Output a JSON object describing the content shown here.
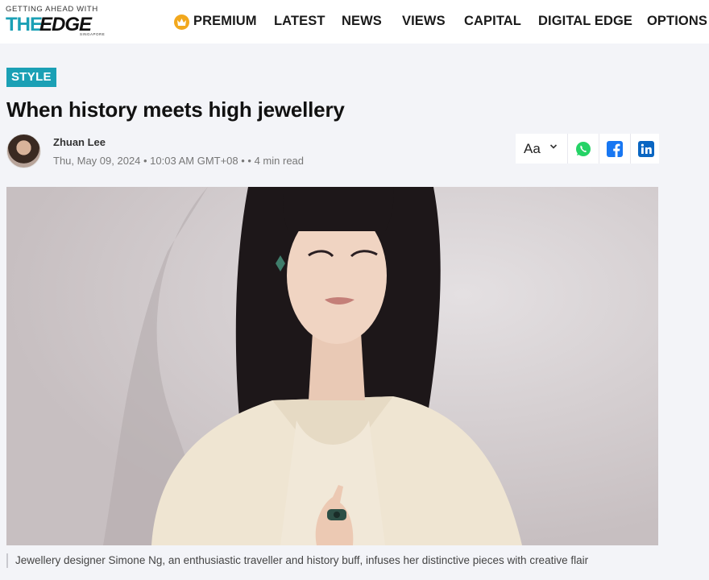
{
  "header": {
    "logo": {
      "tagline": "GETTING AHEAD WITH",
      "word_the": "THE",
      "word_edge": "EDGE",
      "region": "SINGAPORE"
    },
    "nav": [
      {
        "label": "PREMIUM",
        "icon": "crown-icon"
      },
      {
        "label": "LATEST"
      },
      {
        "label": "NEWS"
      },
      {
        "label": "VIEWS"
      },
      {
        "label": "CAPITAL"
      },
      {
        "label": "DIGITAL EDGE"
      },
      {
        "label": "OPTIONS"
      }
    ]
  },
  "article": {
    "category": "STYLE",
    "title": "When history meets high jewellery",
    "author": "Zhuan Lee",
    "meta": "Thu, May 09, 2024 • 10:03 AM GMT+08 •  • 4 min read",
    "tools": {
      "font_size_label": "Aa",
      "share": [
        "whatsapp-icon",
        "facebook-icon",
        "linkedin-icon"
      ]
    },
    "image_caption": "Jewellery designer Simone Ng, an enthusiastic traveller and history buff, infuses her distinctive pieces with creative flair"
  },
  "colors": {
    "accent": "#1ba0b5",
    "premium": "#f2a81d",
    "whatsapp": "#25d366",
    "facebook": "#1877f2",
    "linkedin": "#0a66c2",
    "page_bg": "#f3f4f8"
  }
}
